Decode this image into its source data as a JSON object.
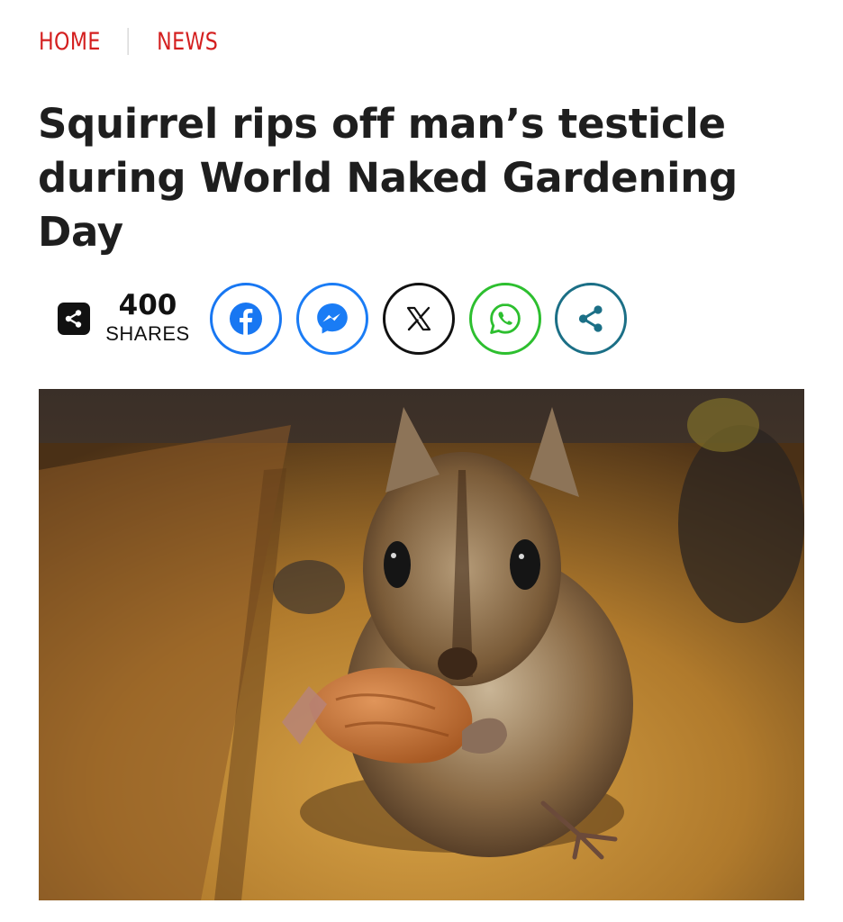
{
  "breadcrumb": {
    "home_label": "HOME",
    "news_label": "NEWS"
  },
  "article": {
    "headline": "Squirrel rips off man’s testicle during World Naked Gardening Day"
  },
  "share_bar": {
    "count": "400",
    "count_label": "SHARES",
    "buttons": [
      {
        "icon": "facebook-icon",
        "color": "#1877f2"
      },
      {
        "icon": "messenger-icon",
        "color": "#1a7cf5"
      },
      {
        "icon": "x-icon",
        "color": "#111111"
      },
      {
        "icon": "whatsapp-icon",
        "color": "#2dbf2f"
      },
      {
        "icon": "share-icon",
        "color": "#1b6f86"
      }
    ]
  },
  "colors": {
    "accent": "#d41f1f",
    "headline": "#1e1e1e"
  },
  "hero_image": {
    "subject": "chipmunk holding a walnut"
  }
}
